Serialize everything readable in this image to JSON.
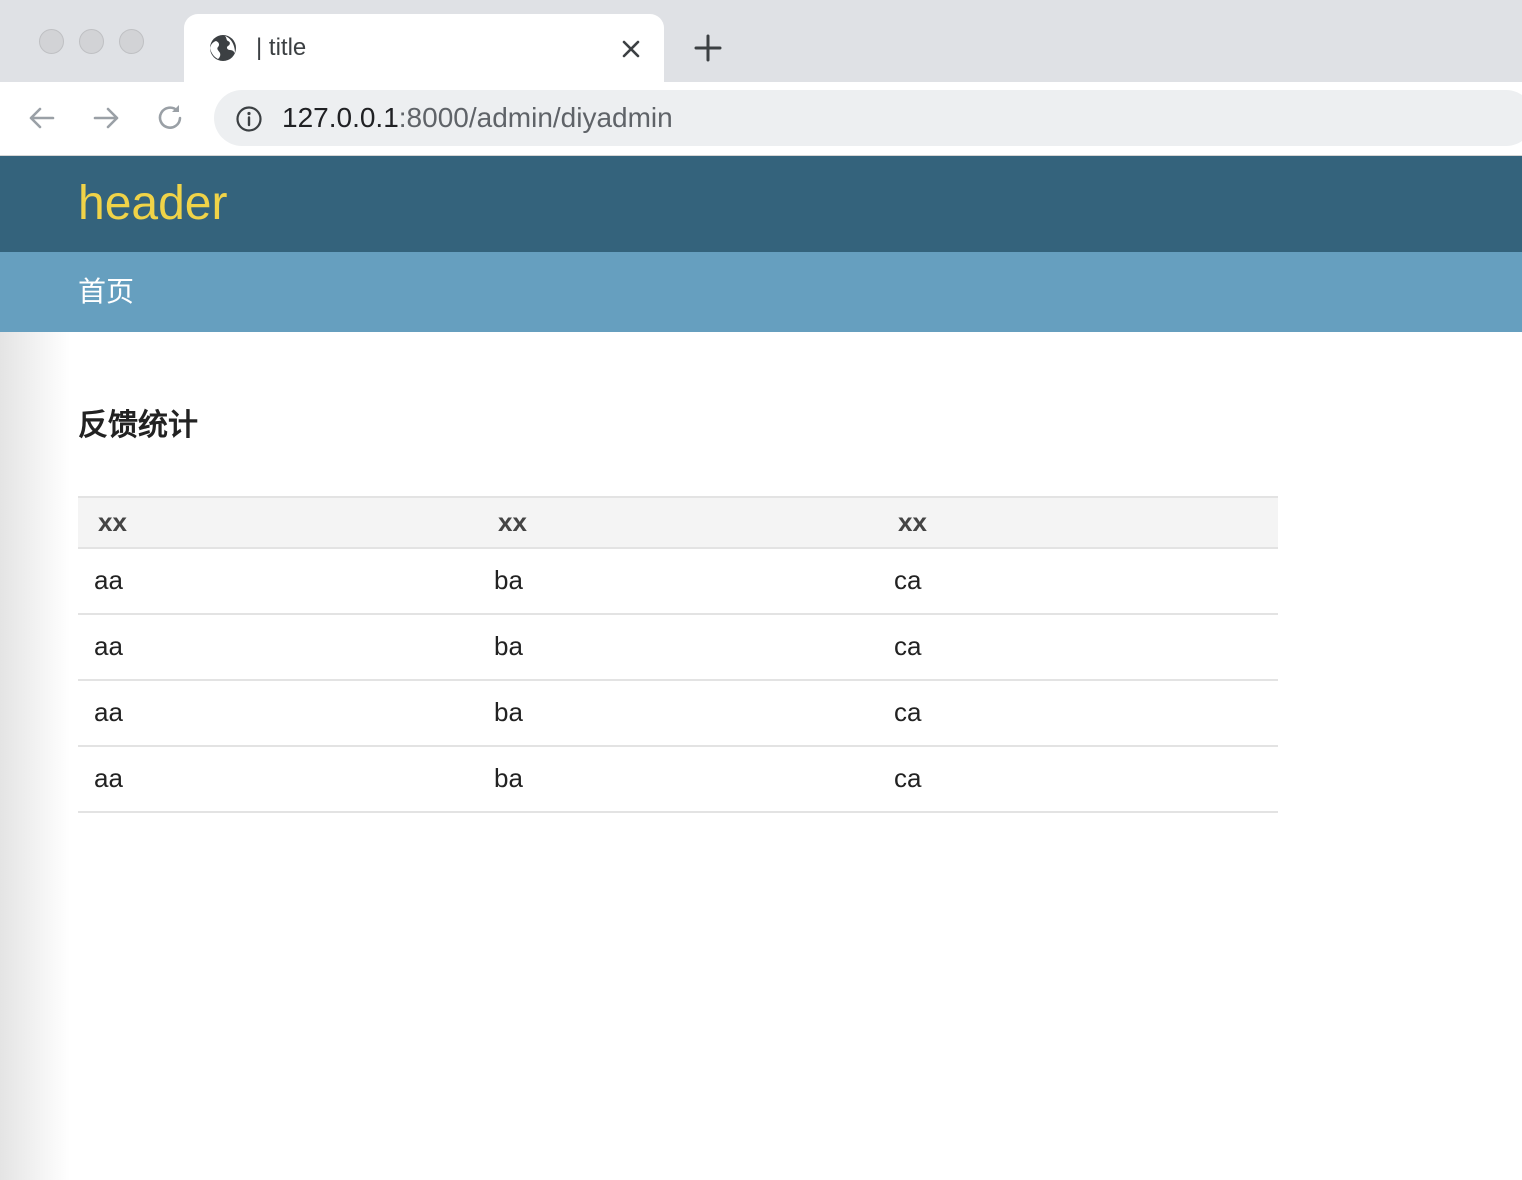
{
  "browser": {
    "tab_title": "| title",
    "url_host": "127.0.0.1",
    "url_path": ":8000/admin/diyadmin"
  },
  "page": {
    "header_title": "header",
    "nav_items": [
      "首页"
    ],
    "section_title": "反馈统计",
    "table": {
      "headers": [
        "xx",
        "xx",
        "xx"
      ],
      "rows": [
        [
          "aa",
          "ba",
          "ca"
        ],
        [
          "aa",
          "ba",
          "ca"
        ],
        [
          "aa",
          "ba",
          "ca"
        ],
        [
          "aa",
          "ba",
          "ca"
        ]
      ]
    }
  },
  "colors": {
    "header_bg": "#34637c",
    "header_text": "#f0d348",
    "nav_bg": "#669fbf"
  },
  "icons": {
    "tab_favicon": "globe-icon",
    "tab_close": "close-icon",
    "new_tab": "plus-icon",
    "back": "back-arrow-icon",
    "forward": "forward-arrow-icon",
    "reload": "reload-icon",
    "site_info": "info-icon"
  }
}
